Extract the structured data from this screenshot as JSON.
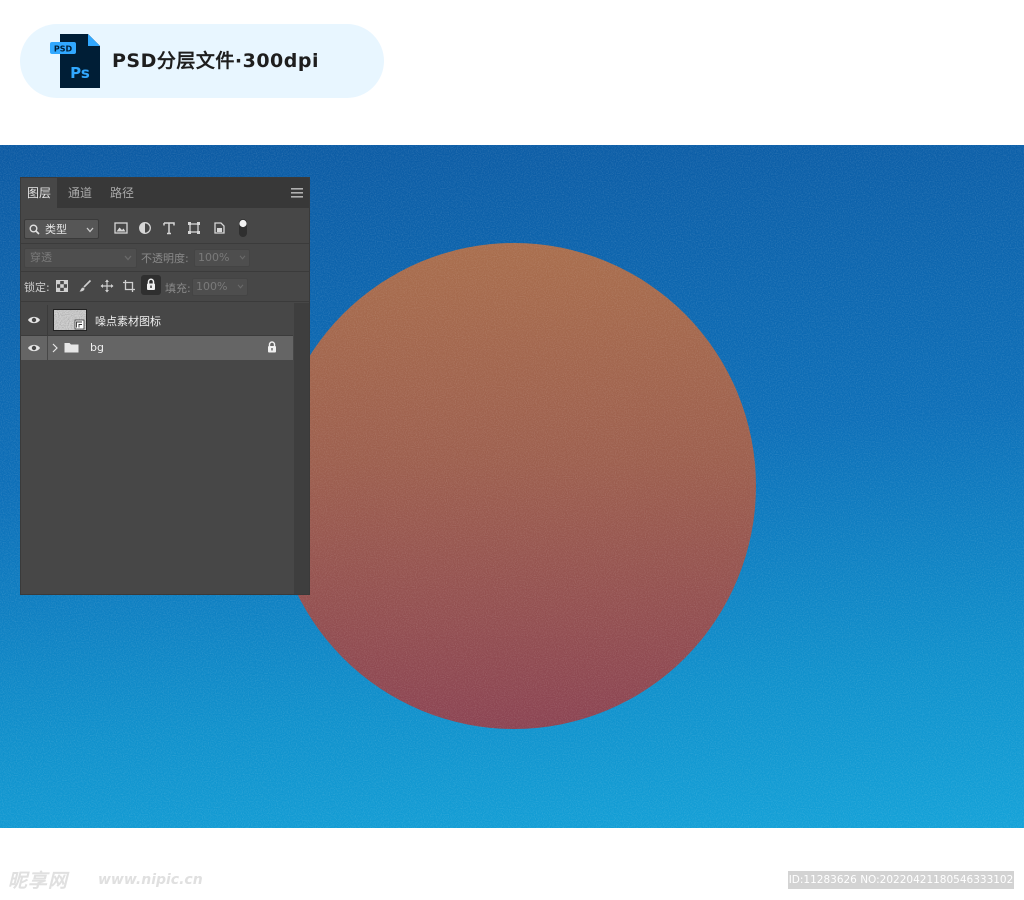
{
  "header": {
    "file_icon_badge": "PSD",
    "file_icon_mark": "Ps",
    "title": "PSD分层文件·300dpi"
  },
  "layers_panel": {
    "tabs": [
      {
        "label": "图层",
        "active": true
      },
      {
        "label": "通道",
        "active": false
      },
      {
        "label": "路径",
        "active": false
      }
    ],
    "filter": {
      "kind_label": "类型",
      "icons": [
        "image-filter-icon",
        "adjustment-filter-icon",
        "text-filter-icon",
        "shape-filter-icon",
        "smart-object-filter-icon",
        "filter-toggle-icon"
      ]
    },
    "blend_mode": "穿透",
    "opacity_label": "不透明度:",
    "opacity_value": "100%",
    "lock_label": "锁定:",
    "lock_icons": [
      "lock-transparent-icon",
      "lock-image-icon",
      "lock-position-icon",
      "lock-artboard-icon",
      "lock-all-icon"
    ],
    "fill_label": "填充:",
    "fill_value": "100%",
    "layers": [
      {
        "name": "噪点素材图标",
        "type": "image",
        "visible": true,
        "selected": false,
        "locked": false
      },
      {
        "name": "bg",
        "type": "group",
        "visible": true,
        "selected": true,
        "locked": true
      }
    ]
  },
  "watermark": {
    "logo": "昵享网",
    "url": "www.nipic.cn",
    "id_text": "ID:11283626 NO:20220421180546333102"
  },
  "colors": {
    "canvas_top": "#0c5aa3",
    "canvas_bottom": "#14a2d8",
    "circle_top": "#a96e4d",
    "circle_bottom": "#8c4453",
    "panel_bg": "#474747",
    "panel_tabbar": "#383838",
    "header_pill": "#e8f6ff",
    "ps_blue": "#31a8ff",
    "ps_dark": "#001e36"
  }
}
